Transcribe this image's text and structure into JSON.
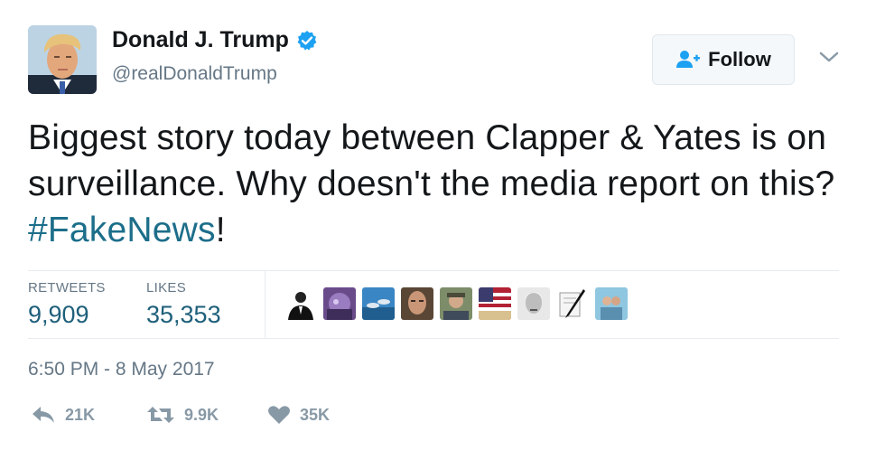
{
  "user": {
    "name": "Donald J. Trump",
    "handle": "@realDonaldTrump",
    "verified": true
  },
  "follow_button": {
    "label": "Follow",
    "icon": "follow-user-icon"
  },
  "tweet": {
    "text_before_hashtag": "Biggest story today between Clapper & Yates is on surveillance. Why doesn't the media report on this? ",
    "hashtag": "#FakeNews",
    "text_after_hashtag": "!"
  },
  "stats": {
    "retweets_label": "RETWEETS",
    "retweets_value": "9,909",
    "likes_label": "LIKES",
    "likes_value": "35,353"
  },
  "likers_avatars": [
    "avatar-1",
    "avatar-2",
    "avatar-3",
    "avatar-4",
    "avatar-5",
    "avatar-6",
    "avatar-7",
    "avatar-8",
    "avatar-9"
  ],
  "timestamp": "6:50 PM - 8 May 2017",
  "actions": {
    "reply_count": "21K",
    "retweet_count": "9.9K",
    "like_count": "35K"
  },
  "colors": {
    "text": "#14171a",
    "secondary": "#657786",
    "hashtag": "#1c6e8a",
    "verified": "#1da1f2",
    "action_gray": "#8899a6"
  }
}
